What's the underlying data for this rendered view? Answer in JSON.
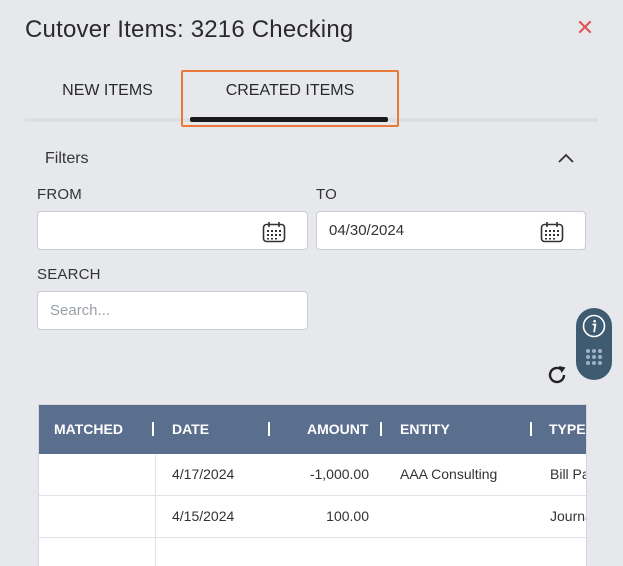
{
  "dialog": {
    "title": "Cutover Items: 3216 Checking",
    "close_icon": "close-icon"
  },
  "tabs": [
    {
      "label": "NEW ITEMS",
      "active": false
    },
    {
      "label": "CREATED ITEMS",
      "active": true
    }
  ],
  "filters": {
    "heading": "Filters",
    "collapse_icon": "chevron-up-icon",
    "from": {
      "label": "FROM",
      "value": "",
      "icon": "calendar-icon"
    },
    "to": {
      "label": "TO",
      "value": "04/30/2024",
      "icon": "calendar-icon"
    },
    "search": {
      "label": "SEARCH",
      "value": "",
      "placeholder": "Search..."
    }
  },
  "side_widget": {
    "info_icon": "info-icon",
    "menu_icon": "grid-dots-icon"
  },
  "refresh_icon": "refresh-icon",
  "table": {
    "columns": [
      "MATCHED",
      "DATE",
      "AMOUNT",
      "ENTITY",
      "TYPE"
    ],
    "rows": [
      {
        "matched": "",
        "date": "4/17/2024",
        "amount": "-1,000.00",
        "entity": "AAA Consulting",
        "type": "Bill Pa"
      },
      {
        "matched": "",
        "date": "4/15/2024",
        "amount": "100.00",
        "entity": "",
        "type": "Journa"
      }
    ]
  },
  "colors": {
    "accent_highlight": "#e8793a",
    "close": "#e05555",
    "table_header": "#5a6e8e",
    "side_widget": "#3f5b72"
  }
}
